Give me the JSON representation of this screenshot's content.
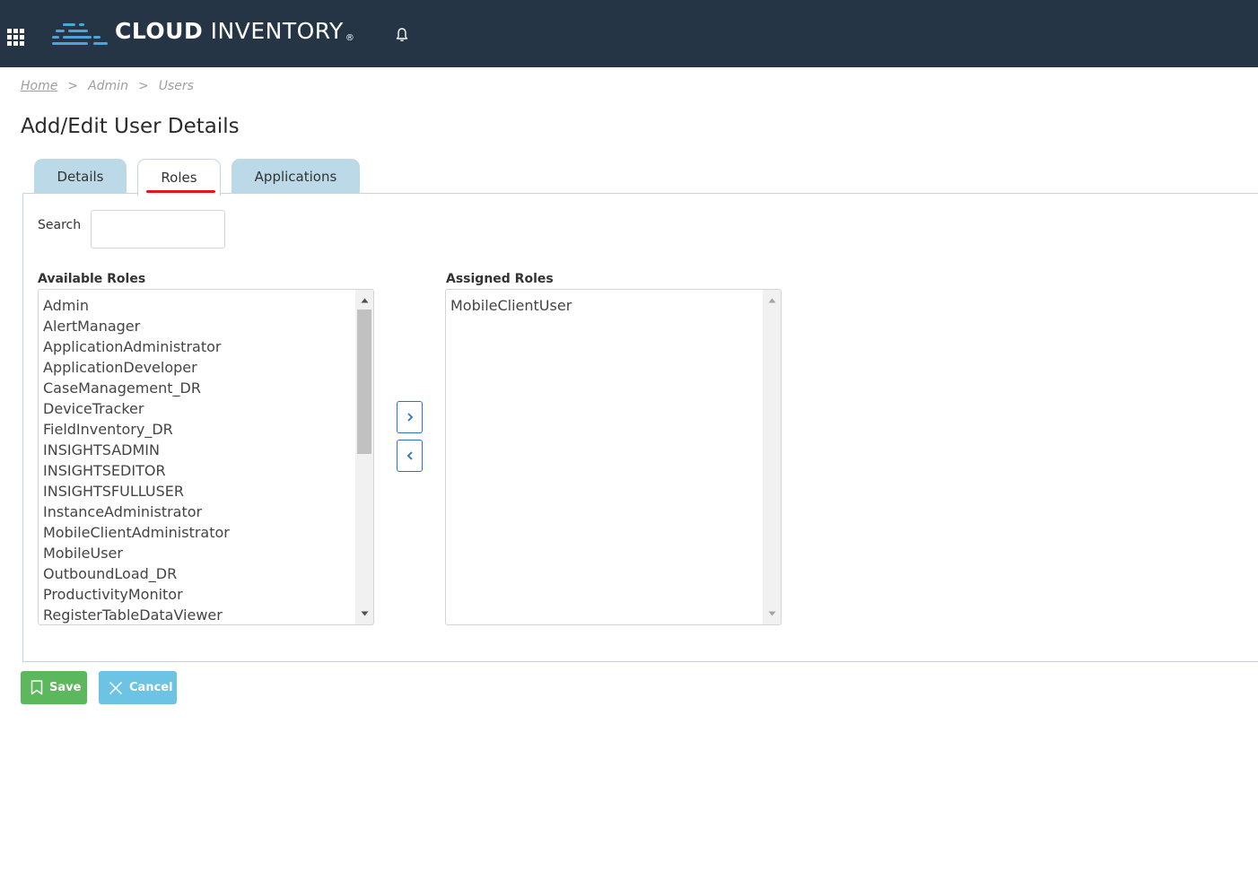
{
  "header": {
    "brand_bold": "CLOUD",
    "brand_light": " INVENTORY",
    "brand_reg": "®",
    "icons": [
      "app-grid-icon",
      "cloud-inventory-logo",
      "bell-icon"
    ],
    "background_color": "#263545"
  },
  "breadcrumb": {
    "home": "Home",
    "separator": ">",
    "admin": "Admin",
    "users": "Users"
  },
  "page": {
    "title": "Add/Edit User Details"
  },
  "tabs": [
    {
      "label": "Details",
      "active": false
    },
    {
      "label": "Roles",
      "active": true
    },
    {
      "label": "Applications",
      "active": false
    }
  ],
  "search": {
    "label": "Search",
    "value": "",
    "placeholder": ""
  },
  "available_roles": {
    "label": "Available Roles",
    "items": [
      "Admin",
      "AlertManager",
      "ApplicationAdministrator",
      "ApplicationDeveloper",
      "CaseManagement_DR",
      "DeviceTracker",
      "FieldInventory_DR",
      "INSIGHTSADMIN",
      "INSIGHTSEDITOR",
      "INSIGHTSFULLUSER",
      "InstanceAdministrator",
      "MobileClientAdministrator",
      "MobileUser",
      "OutboundLoad_DR",
      "ProductivityMonitor",
      "RegisterTableDataViewer"
    ]
  },
  "assigned_roles": {
    "label": "Assigned Roles",
    "items": [
      "MobileClientUser"
    ]
  },
  "move_buttons": {
    "add_icon": "chevron-right-icon",
    "remove_icon": "chevron-left-icon"
  },
  "actions": {
    "save_label": "Save",
    "cancel_label": "Cancel",
    "save_color": "#5cb85c",
    "cancel_color": "#6cc3e3"
  },
  "colors": {
    "accent_underline": "#e5141f",
    "tab_background": "#bcd9e8"
  }
}
